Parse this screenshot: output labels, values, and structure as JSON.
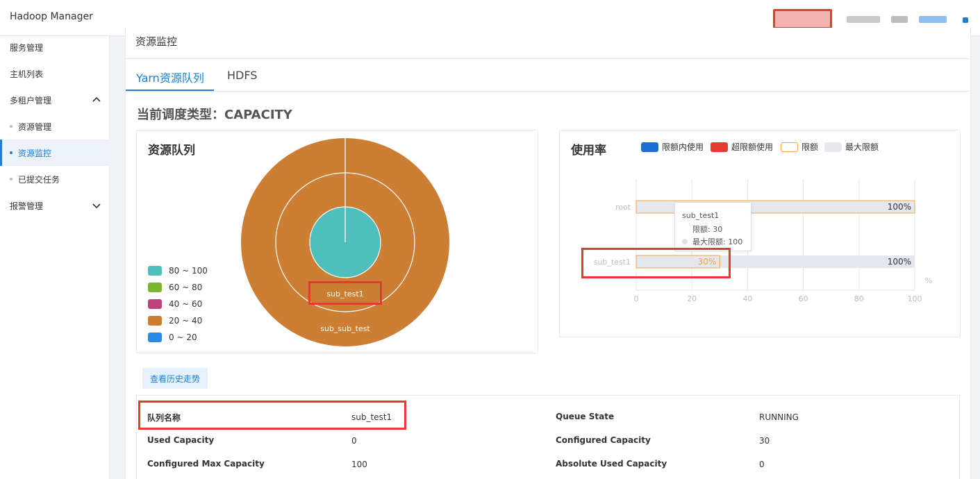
{
  "header": {
    "app_title": "Hadoop Manager"
  },
  "sidebar": {
    "items": [
      {
        "label": "服务管理"
      },
      {
        "label": "主机列表"
      },
      {
        "label": "多租户管理"
      },
      {
        "label": "资源管理"
      },
      {
        "label": "资源监控"
      },
      {
        "label": "已提交任务"
      },
      {
        "label": "报警管理"
      }
    ]
  },
  "page": {
    "title": "资源监控",
    "tabs": [
      {
        "label": "Yarn资源队列"
      },
      {
        "label": "HDFS"
      }
    ],
    "scheduler_type": "当前调度类型：CAPACITY"
  },
  "queue_panel": {
    "title": "资源队列",
    "legend": [
      {
        "label": "80 ~ 100",
        "color": "#4fbfbb"
      },
      {
        "label": "60 ~ 80",
        "color": "#7cb530"
      },
      {
        "label": "40 ~ 60",
        "color": "#c0427a"
      },
      {
        "label": "20 ~ 40",
        "color": "#cc7e34"
      },
      {
        "label": "0 ~ 20",
        "color": "#2a8be6"
      }
    ],
    "labels": {
      "middle": "sub_test1",
      "outer": "sub_sub_test"
    }
  },
  "usage_panel": {
    "title": "使用率",
    "legend": [
      {
        "label": "限额内使用",
        "color": "#1a6fd6"
      },
      {
        "label": "超限额使用",
        "color": "#e53a2f"
      },
      {
        "label": "限额",
        "color": "#f3a14a"
      },
      {
        "label": "最大限额",
        "color": "#e4e7ed"
      }
    ],
    "tooltip": {
      "title": "sub_test1",
      "limit_line": "限额: 30",
      "max_line": "最大限额: 100"
    }
  },
  "chart_data": {
    "type": "bar",
    "orientation": "horizontal",
    "categories": [
      "root",
      "sub_test1"
    ],
    "series": [
      {
        "name": "限额",
        "values": [
          100,
          30
        ]
      },
      {
        "name": "最大限额",
        "values": [
          100,
          100
        ]
      }
    ],
    "value_labels": [
      "100%",
      "30%"
    ],
    "max_labels": [
      "100%",
      "100%"
    ],
    "x_ticks": [
      "0",
      "20",
      "40",
      "60",
      "80",
      "100"
    ],
    "xlim": [
      0,
      100
    ],
    "unit": "%",
    "grid": true
  },
  "actions": {
    "history_label": "查看历史走势"
  },
  "details": {
    "rows": [
      {
        "l1": "队列名称",
        "v1": "sub_test1",
        "l2": "Queue State",
        "v2": "RUNNING"
      },
      {
        "l1": "Used Capacity",
        "v1": "0",
        "l2": "Configured Capacity",
        "v2": "30"
      },
      {
        "l1": "Configured Max Capacity",
        "v1": "100",
        "l2": "Absolute Used Capacity",
        "v2": "0"
      }
    ]
  }
}
